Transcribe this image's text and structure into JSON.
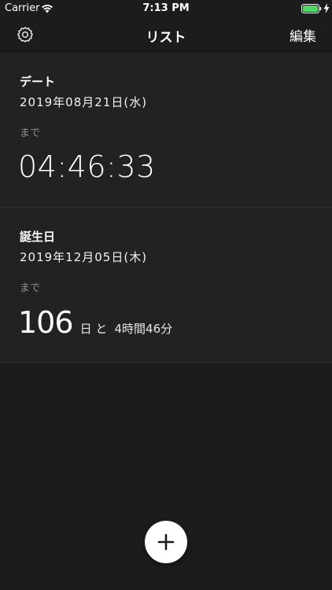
{
  "status_bar": {
    "carrier": "Carrier",
    "time": "7:13 PM"
  },
  "nav": {
    "title": "リスト",
    "edit_label": "編集"
  },
  "events": [
    {
      "title": "デート",
      "date": "2019年08月21日(水)",
      "until_label": "まで",
      "countdown": "04:46:33"
    },
    {
      "title": "誕生日",
      "date": "2019年12月05日(木)",
      "until_label": "まで",
      "days": "106",
      "days_unit": "日 と",
      "rest": "4時間46分"
    }
  ],
  "colors": {
    "background": "#1c1c1c",
    "card": "#222222",
    "battery": "#4cd964",
    "muted_text": "#8e8e8e"
  }
}
